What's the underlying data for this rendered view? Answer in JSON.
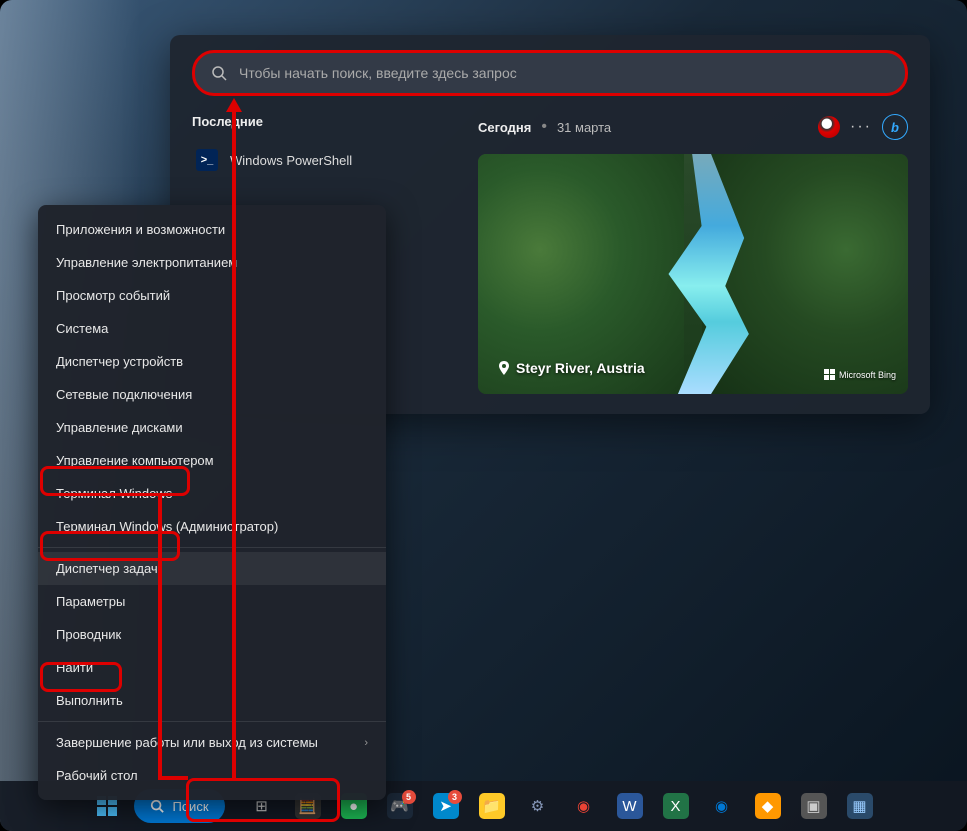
{
  "search": {
    "placeholder": "Чтобы начать поиск, введите здесь запрос"
  },
  "recent": {
    "header": "Последние",
    "items": [
      {
        "label": "Windows PowerShell",
        "icon": "powershell"
      }
    ]
  },
  "today": {
    "label": "Сегодня",
    "date": "31 марта",
    "hero_location": "Steyr River, Austria",
    "brand": "Microsoft Bing"
  },
  "context_menu": {
    "items": [
      {
        "label": "Приложения и возможности"
      },
      {
        "label": "Управление электропитанием"
      },
      {
        "label": "Просмотр событий"
      },
      {
        "label": "Система"
      },
      {
        "label": "Диспетчер устройств"
      },
      {
        "label": "Сетевые подключения"
      },
      {
        "label": "Управление дисками"
      },
      {
        "label": "Управление компьютером"
      },
      {
        "label": "Терминал Windows",
        "highlight": true
      },
      {
        "label": "Терминал Windows (Администратор)"
      },
      {
        "label": "Диспетчер задач",
        "highlight": true,
        "hover": true,
        "sep_before": true
      },
      {
        "label": "Параметры"
      },
      {
        "label": "Проводник"
      },
      {
        "label": "Найти"
      },
      {
        "label": "Выполнить",
        "highlight": true
      },
      {
        "label": "Завершение работы или выход из системы",
        "submenu": true,
        "sep_before": true
      },
      {
        "label": "Рабочий стол"
      }
    ]
  },
  "taskbar": {
    "search_label": "Поиск",
    "icons": [
      {
        "name": "task-view",
        "glyph": "⊞",
        "color": "#ccc"
      },
      {
        "name": "calculator",
        "glyph": "🧮",
        "bg": "#333"
      },
      {
        "name": "spotify",
        "glyph": "●",
        "bg": "#1db954",
        "color": "#fff"
      },
      {
        "name": "steam",
        "glyph": "🎮",
        "bg": "#1b2838",
        "color": "#66c0f4",
        "badge": "5"
      },
      {
        "name": "telegram",
        "glyph": "➤",
        "bg": "#0088cc",
        "color": "#fff",
        "badge": "3"
      },
      {
        "name": "explorer",
        "glyph": "📁",
        "bg": "#ffca28"
      },
      {
        "name": "settings",
        "glyph": "⚙",
        "color": "#89b"
      },
      {
        "name": "chrome",
        "glyph": "◉",
        "color": "#ea4335"
      },
      {
        "name": "word",
        "glyph": "W",
        "bg": "#2b579a",
        "color": "#fff"
      },
      {
        "name": "excel",
        "glyph": "X",
        "bg": "#217346",
        "color": "#fff"
      },
      {
        "name": "edge",
        "glyph": "◉",
        "color": "#0078d4"
      },
      {
        "name": "app1",
        "glyph": "◆",
        "bg": "#ff9800",
        "color": "#fff"
      },
      {
        "name": "app2",
        "glyph": "▣",
        "bg": "#555",
        "color": "#ccc"
      },
      {
        "name": "app3",
        "glyph": "▦",
        "bg": "#2a4a6a",
        "color": "#9cf"
      }
    ]
  }
}
